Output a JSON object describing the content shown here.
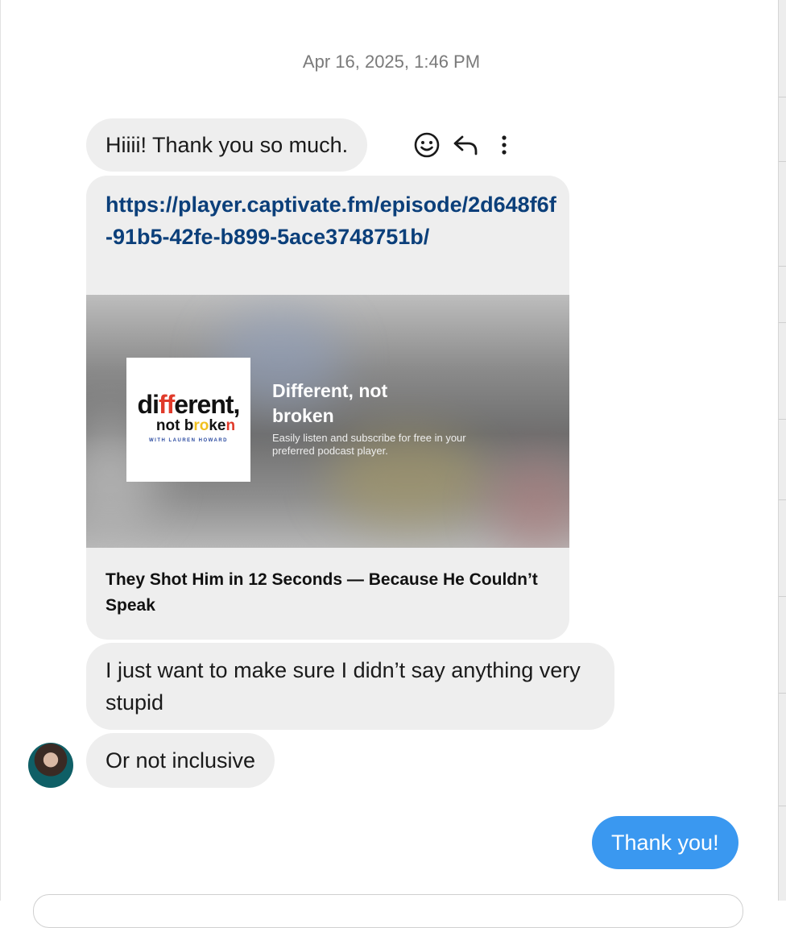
{
  "conversation": {
    "timestamp": "Apr 16, 2025, 1:46 PM",
    "messages": {
      "m1": "Hiiii! Thank you so much.",
      "m2": {
        "url": "https://player.captivate.fm/episode/2d648f6f-91b5-42fe-b899-5ace3748751b/",
        "preview": {
          "logo_line1_a": "di",
          "logo_line1_b": "ff",
          "logo_line1_c": "erent,",
          "logo_line2_a": "not b",
          "logo_line2_b": "r",
          "logo_line2_c": "o",
          "logo_line2_d": "ke",
          "logo_line2_e": "n",
          "logo_byline": "WITH LAUREN HOWARD",
          "title": "Different, not broken",
          "description": "Easily listen and subscribe for free in your preferred podcast player."
        },
        "episode_title": "They Shot Him in 12 Seconds — Because He Couldn’t Speak"
      },
      "m3": "I just want to make sure I didn’t say anything very stupid",
      "m4": "Or not inclusive",
      "sent1": "Thank you!"
    }
  },
  "icons": {
    "react": "smiley-icon",
    "reply": "reply-arrow-icon",
    "more": "more-vertical-icon"
  },
  "colors": {
    "sent_bubble": "#3a98f0",
    "received_bubble": "#eeeeee",
    "link": "#0b3f7a"
  }
}
